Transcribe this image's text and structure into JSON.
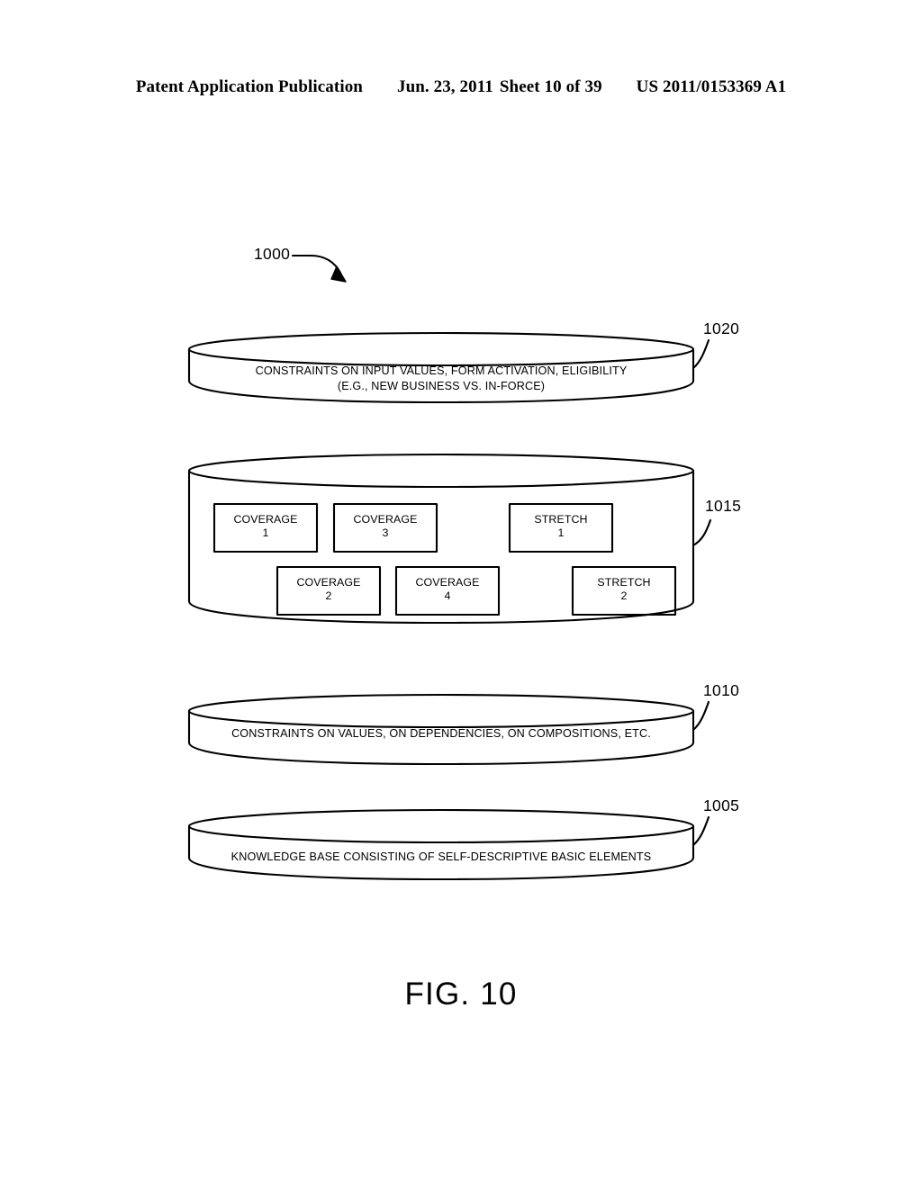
{
  "header": {
    "publication": "Patent Application Publication",
    "date": "Jun. 23, 2011",
    "sheet": "Sheet 10 of 39",
    "patent_number": "US 2011/0153369 A1"
  },
  "figure": {
    "caption": "FIG. 10",
    "diagram_ref": "1000",
    "layers": [
      {
        "ref": "1020",
        "line1": "CONSTRAINTS ON INPUT VALUES, FORM ACTIVATION, ELIGIBILITY",
        "line2": "(E.G., NEW BUSINESS VS. IN-FORCE)"
      },
      {
        "ref": "1015",
        "boxes": [
          {
            "name": "COVERAGE",
            "number": "1"
          },
          {
            "name": "COVERAGE",
            "number": "3"
          },
          {
            "name": "STRETCH",
            "number": "1"
          },
          {
            "name": "COVERAGE",
            "number": "2"
          },
          {
            "name": "COVERAGE",
            "number": "4"
          },
          {
            "name": "STRETCH",
            "number": "2"
          }
        ]
      },
      {
        "ref": "1010",
        "line1": "CONSTRAINTS ON VALUES, ON DEPENDENCIES, ON COMPOSITIONS, ETC."
      },
      {
        "ref": "1005",
        "line1": "KNOWLEDGE BASE CONSISTING OF SELF-DESCRIPTIVE BASIC ELEMENTS"
      }
    ]
  },
  "colors": {
    "ink": "#000000",
    "paper": "#ffffff"
  }
}
